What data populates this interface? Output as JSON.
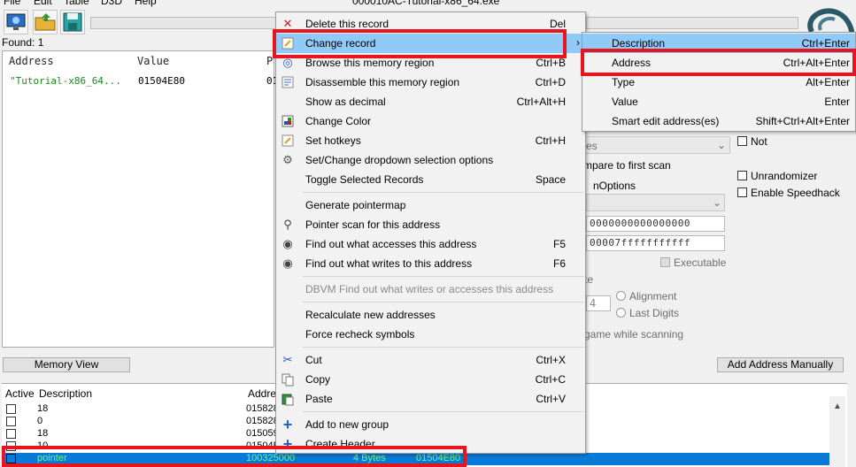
{
  "window": {
    "title": "000010AC-Tutorial-x86_64.exe",
    "menu": [
      "File",
      "Edit",
      "Table",
      "D3D",
      "Help"
    ]
  },
  "found": "Found: 1",
  "results": {
    "headers": [
      "Address",
      "Value",
      "P"
    ],
    "row": {
      "address": "\"Tutorial-x86_64...",
      "value": "01504E80",
      "prev": "01"
    }
  },
  "buttons": {
    "memory_view": "Memory View",
    "add_address_manually": "Add Address Manually"
  },
  "scan_options": {
    "not": "Not",
    "compare_first": "mpare to first scan",
    "options_label": "nOptions",
    "hex_start": "0000000000000000",
    "hex_end": "00007fffffffffff",
    "executable": "Executable",
    "te": "te",
    "alignment": "Alignment",
    "last_digits": "Last Digits",
    "align_value": "4",
    "pause": "game while scanning",
    "unrandomizer": "Unrandomizer",
    "speedhack": "Enable Speedhack",
    "es": "es"
  },
  "address_list": {
    "headers": [
      "Active",
      "Description",
      "Addre"
    ],
    "rows": [
      {
        "desc": "18",
        "addr": "015828"
      },
      {
        "desc": "0",
        "addr": "015828"
      },
      {
        "desc": "18",
        "addr": "015059"
      },
      {
        "desc": "10",
        "addr": "01504E"
      }
    ],
    "selected": {
      "desc": "pointer",
      "addr": "100325000",
      "type": "4 Bytes",
      "value": "01504E80"
    }
  },
  "context_menu": {
    "items": [
      {
        "label": "Delete this record",
        "shortcut": "Del",
        "icon": "x"
      },
      {
        "label": "Change record",
        "shortcut": "",
        "icon": "edit"
      },
      {
        "label": "Browse this memory region",
        "shortcut": "Ctrl+B",
        "icon": "binoculars"
      },
      {
        "label": "Disassemble this memory region",
        "shortcut": "Ctrl+D",
        "icon": "disasm"
      },
      {
        "label": "Show as decimal",
        "shortcut": "Ctrl+Alt+H",
        "icon": ""
      },
      {
        "label": "Change Color",
        "shortcut": "",
        "icon": "color"
      },
      {
        "label": "Set hotkeys",
        "shortcut": "Ctrl+H",
        "icon": "hotkey"
      },
      {
        "label": "Set/Change dropdown selection options",
        "shortcut": "",
        "icon": "gear"
      },
      {
        "label": "Toggle Selected Records",
        "shortcut": "Space",
        "icon": ""
      },
      {
        "label": "Generate pointermap",
        "shortcut": "",
        "icon": ""
      },
      {
        "label": "Pointer scan for this address",
        "shortcut": "",
        "icon": "magnifier"
      },
      {
        "label": "Find out what accesses this address",
        "shortcut": "F5",
        "icon": "find"
      },
      {
        "label": "Find out what writes to this address",
        "shortcut": "F6",
        "icon": "find"
      },
      {
        "label": "DBVM Find out what writes or accesses this address",
        "shortcut": "",
        "icon": ""
      },
      {
        "label": "Recalculate new addresses",
        "shortcut": "",
        "icon": ""
      },
      {
        "label": "Force recheck symbols",
        "shortcut": "",
        "icon": ""
      },
      {
        "label": "Cut",
        "shortcut": "Ctrl+X",
        "icon": "scissors"
      },
      {
        "label": "Copy",
        "shortcut": "Ctrl+C",
        "icon": "copy"
      },
      {
        "label": "Paste",
        "shortcut": "Ctrl+V",
        "icon": "paste"
      },
      {
        "label": "Add to new group",
        "shortcut": "",
        "icon": "plus"
      },
      {
        "label": "Create Header",
        "shortcut": "",
        "icon": "plus"
      }
    ]
  },
  "submenu": {
    "items": [
      {
        "label": "Description",
        "shortcut": "Ctrl+Enter"
      },
      {
        "label": "Address",
        "shortcut": "Ctrl+Alt+Enter"
      },
      {
        "label": "Type",
        "shortcut": "Alt+Enter"
      },
      {
        "label": "Value",
        "shortcut": "Enter"
      },
      {
        "label": "Smart edit address(es)",
        "shortcut": "Shift+Ctrl+Alt+Enter"
      }
    ]
  },
  "colors": {
    "highlight": "#91c9f7",
    "annotation_red": "#e8141e",
    "selected_row": "#0a7ad8",
    "green_text": "#1a8a1a"
  }
}
